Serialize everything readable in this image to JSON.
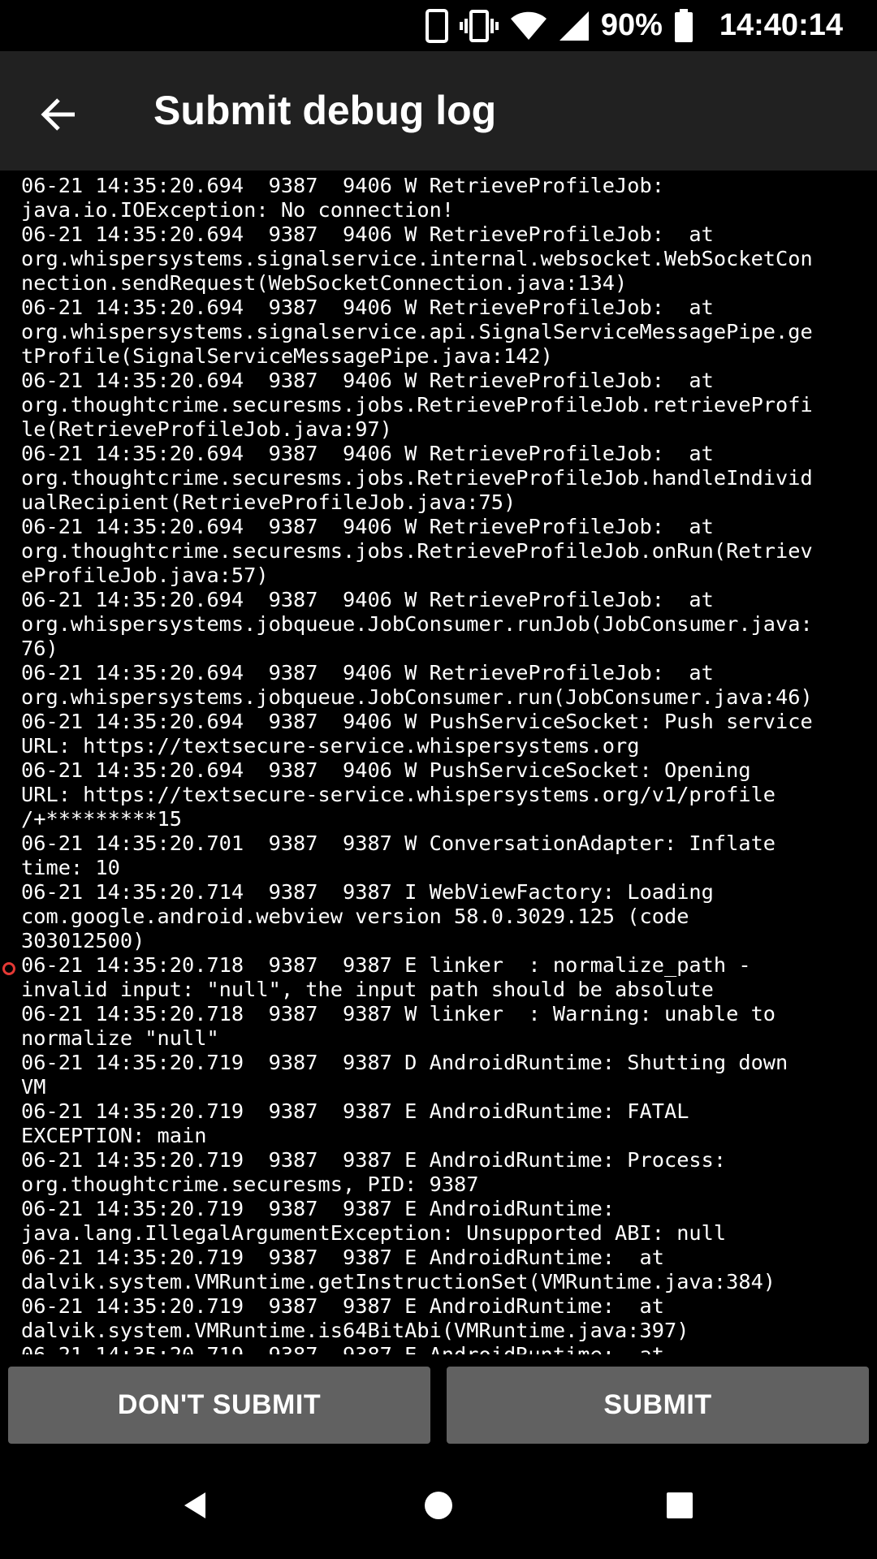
{
  "status_bar": {
    "battery_percent": "90%",
    "time": "14:40:14",
    "icons": [
      "phone-icon",
      "vibrate-icon",
      "wifi-icon",
      "cell-signal-icon",
      "battery-icon"
    ]
  },
  "app_bar": {
    "title": "Submit debug log",
    "back_icon": "arrow-back-icon"
  },
  "log": {
    "text": "06-21 14:35:20.694  9387  9406 W RetrieveProfileJob:\njava.io.IOException: No connection!\n06-21 14:35:20.694  9387  9406 W RetrieveProfileJob:  at\norg.whispersystems.signalservice.internal.websocket.WebSocketCon\nnection.sendRequest(WebSocketConnection.java:134)\n06-21 14:35:20.694  9387  9406 W RetrieveProfileJob:  at\norg.whispersystems.signalservice.api.SignalServiceMessagePipe.ge\ntProfile(SignalServiceMessagePipe.java:142)\n06-21 14:35:20.694  9387  9406 W RetrieveProfileJob:  at\norg.thoughtcrime.securesms.jobs.RetrieveProfileJob.retrieveProfi\nle(RetrieveProfileJob.java:97)\n06-21 14:35:20.694  9387  9406 W RetrieveProfileJob:  at\norg.thoughtcrime.securesms.jobs.RetrieveProfileJob.handleIndivid\nualRecipient(RetrieveProfileJob.java:75)\n06-21 14:35:20.694  9387  9406 W RetrieveProfileJob:  at\norg.thoughtcrime.securesms.jobs.RetrieveProfileJob.onRun(Retriev\neProfileJob.java:57)\n06-21 14:35:20.694  9387  9406 W RetrieveProfileJob:  at\norg.whispersystems.jobqueue.JobConsumer.runJob(JobConsumer.java:\n76)\n06-21 14:35:20.694  9387  9406 W RetrieveProfileJob:  at\norg.whispersystems.jobqueue.JobConsumer.run(JobConsumer.java:46)\n06-21 14:35:20.694  9387  9406 W PushServiceSocket: Push service\nURL: https://textsecure-service.whispersystems.org\n06-21 14:35:20.694  9387  9406 W PushServiceSocket: Opening\nURL: https://textsecure-service.whispersystems.org/v1/profile\n/+*********15\n06-21 14:35:20.701  9387  9387 W ConversationAdapter: Inflate\ntime: 10\n06-21 14:35:20.714  9387  9387 I WebViewFactory: Loading\ncom.google.android.webview version 58.0.3029.125 (code\n303012500)\n06-21 14:35:20.718  9387  9387 E linker  : normalize_path -\ninvalid input: \"null\", the input path should be absolute\n06-21 14:35:20.718  9387  9387 W linker  : Warning: unable to\nnormalize \"null\"\n06-21 14:35:20.719  9387  9387 D AndroidRuntime: Shutting down\nVM\n06-21 14:35:20.719  9387  9387 E AndroidRuntime: FATAL\nEXCEPTION: main\n06-21 14:35:20.719  9387  9387 E AndroidRuntime: Process:\norg.thoughtcrime.securesms, PID: 9387\n06-21 14:35:20.719  9387  9387 E AndroidRuntime:\njava.lang.IllegalArgumentException: Unsupported ABI: null\n06-21 14:35:20.719  9387  9387 E AndroidRuntime:  at\ndalvik.system.VMRuntime.getInstructionSet(VMRuntime.java:384)\n06-21 14:35:20.719  9387  9387 E AndroidRuntime:  at\ndalvik.system.VMRuntime.is64BitAbi(VMRuntime.java:397)\n06-21 14:35:20.719  9387  9387 E AndroidRuntime:  at"
  },
  "buttons": {
    "dont_submit": "DON'T SUBMIT",
    "submit": "SUBMIT"
  },
  "nav_bar": {
    "icons": [
      "nav-back-icon",
      "nav-home-icon",
      "nav-recents-icon"
    ]
  },
  "colors": {
    "app_bar_bg": "#212121",
    "button_bg": "#616161",
    "marker": "#e53935"
  }
}
